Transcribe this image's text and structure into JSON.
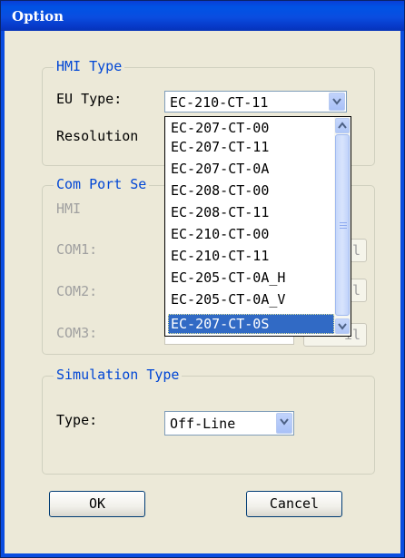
{
  "window": {
    "title": "Option"
  },
  "hmi_type": {
    "legend": "HMI Type",
    "eu_type_label": "EU Type:",
    "eu_type_value": "EC-210-CT-11",
    "resolution_label": "Resolution",
    "options": [
      "EC-207-CT-00",
      "EC-207-CT-11",
      "EC-207-CT-0A",
      "EC-208-CT-00",
      "EC-208-CT-11",
      "EC-210-CT-00",
      "EC-210-CT-11",
      "EC-205-CT-0A_H",
      "EC-205-CT-0A_V",
      "EC-207-CT-0S"
    ],
    "highlighted_option": "EC-207-CT-0S"
  },
  "com_port": {
    "legend": "Com Port Se",
    "hmi_label": "HMI",
    "com1_label": "COM1:",
    "com2_label": "COM2:",
    "com3_label": "COM3:",
    "detail_label": "il"
  },
  "simulation": {
    "legend": "Simulation Type",
    "type_label": "Type:",
    "type_value": "Off-Line"
  },
  "buttons": {
    "ok": "OK",
    "cancel": "Cancel"
  }
}
